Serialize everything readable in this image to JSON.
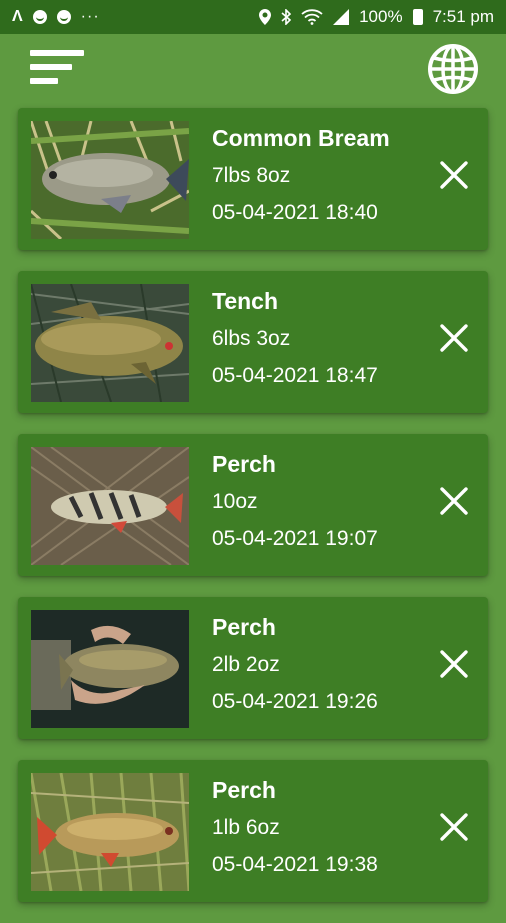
{
  "status_bar": {
    "left_icons": [
      "app-a-icon",
      "notification-icon",
      "notification-icon",
      "more-dots-icon"
    ],
    "battery": "100%",
    "time": "7:51 pm",
    "right_icons": [
      "location-icon",
      "bluetooth-icon",
      "wifi-icon",
      "signal-icon",
      "battery-icon"
    ]
  },
  "app_bar": {
    "menu_icon": "sort-menu-icon",
    "globe_icon": "globe-icon"
  },
  "colors": {
    "background": "#5e9a40",
    "status_bar": "#2f6b1c",
    "card": "#3e7e25",
    "text": "#ffffff"
  },
  "catches": [
    {
      "species": "Common Bream",
      "weight": "7lbs 8oz",
      "datetime": "05-04-2021 18:40"
    },
    {
      "species": "Tench",
      "weight": "6lbs 3oz",
      "datetime": "05-04-2021 18:47"
    },
    {
      "species": "Perch",
      "weight": "10oz",
      "datetime": "05-04-2021 19:07"
    },
    {
      "species": "Perch",
      "weight": "2lb 2oz",
      "datetime": "05-04-2021 19:26"
    },
    {
      "species": "Perch",
      "weight": "1lb 6oz",
      "datetime": "05-04-2021 19:38"
    }
  ]
}
